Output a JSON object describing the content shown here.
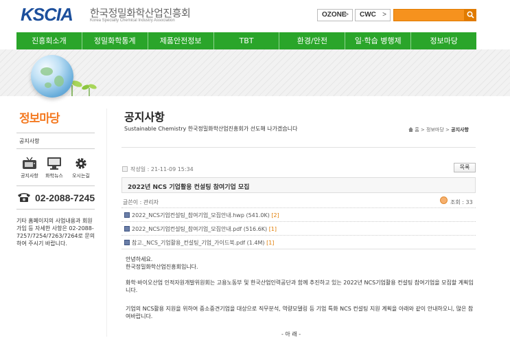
{
  "header": {
    "logo_text": "KSCIA",
    "org_name_ko": "한국정밀화학산업진흥회",
    "org_name_en": "Korea Specialty Chemical Industry Association",
    "ext_buttons": [
      "OZONE",
      "CWC"
    ],
    "arrow_glyph": ">"
  },
  "gnb": [
    "진흥회소개",
    "정밀화학통계",
    "제품안전정보",
    "TBT",
    "환경/안전",
    "일·학습 병행제",
    "정보마당"
  ],
  "sidebar": {
    "title": "정보마당",
    "menu_item": "공지사항",
    "quick_icons": [
      "공지사항",
      "화학뉴스",
      "오시는길"
    ],
    "phone": "02-2088-7245",
    "desc": "기타 홈페이지의 사업내용과 회원가입 등 자세한 사항은 02-2088-7257/7254/7263/7264로 문의하여 주시기 바랍니다."
  },
  "content": {
    "page_title": "공지사항",
    "page_subtitle": "Sustainable Chemistry 한국정밀화학산업진흥회가 선도해 나가겠습니다",
    "breadcrumb": [
      "홈",
      "정보마당",
      "공지사항"
    ],
    "breadcrumb_sep": ">",
    "date": "작성일 : 21-11-09 15:34",
    "list_button": "목록",
    "post_title": "2022년 NCS 기업활용 컨설팅 참여기업 모집",
    "author": "글쓴이 : 관리자",
    "views": "조회 : 33",
    "files": [
      {
        "name": "2022_NCS기업컨설팅_참여기업_모집안내.hwp (541.0K)",
        "count": "[2]"
      },
      {
        "name": "2022_NCS기업컨설팅_참여기업_모집안내.pdf (516.6K)",
        "count": "[1]"
      },
      {
        "name": "참고._NCS_기업활용_컨설팅_기업_가이드북.pdf (1.4M)",
        "count": "[1]"
      }
    ],
    "body": [
      "안녕하세요.",
      "한국정밀화학산업진흥회입니다.",
      "화학·바이오산업 인적자원개발위원회는 고용노동부 및 한국산업인력공단과 함께 추진하고 있는 2022년 NCS기업활용 컨설팅 참여기업을 모집할 계획입니다.",
      "기업의 NCS활용 지원을 위하여 중소중견기업을 대상으로 직무분석, 역량모델링 등 기업 특화 NCS 컨설팅 지원 계획을 아래와 같이 안내하오니, 많은 참여바랍니다.",
      "- 아 래 -"
    ]
  }
}
